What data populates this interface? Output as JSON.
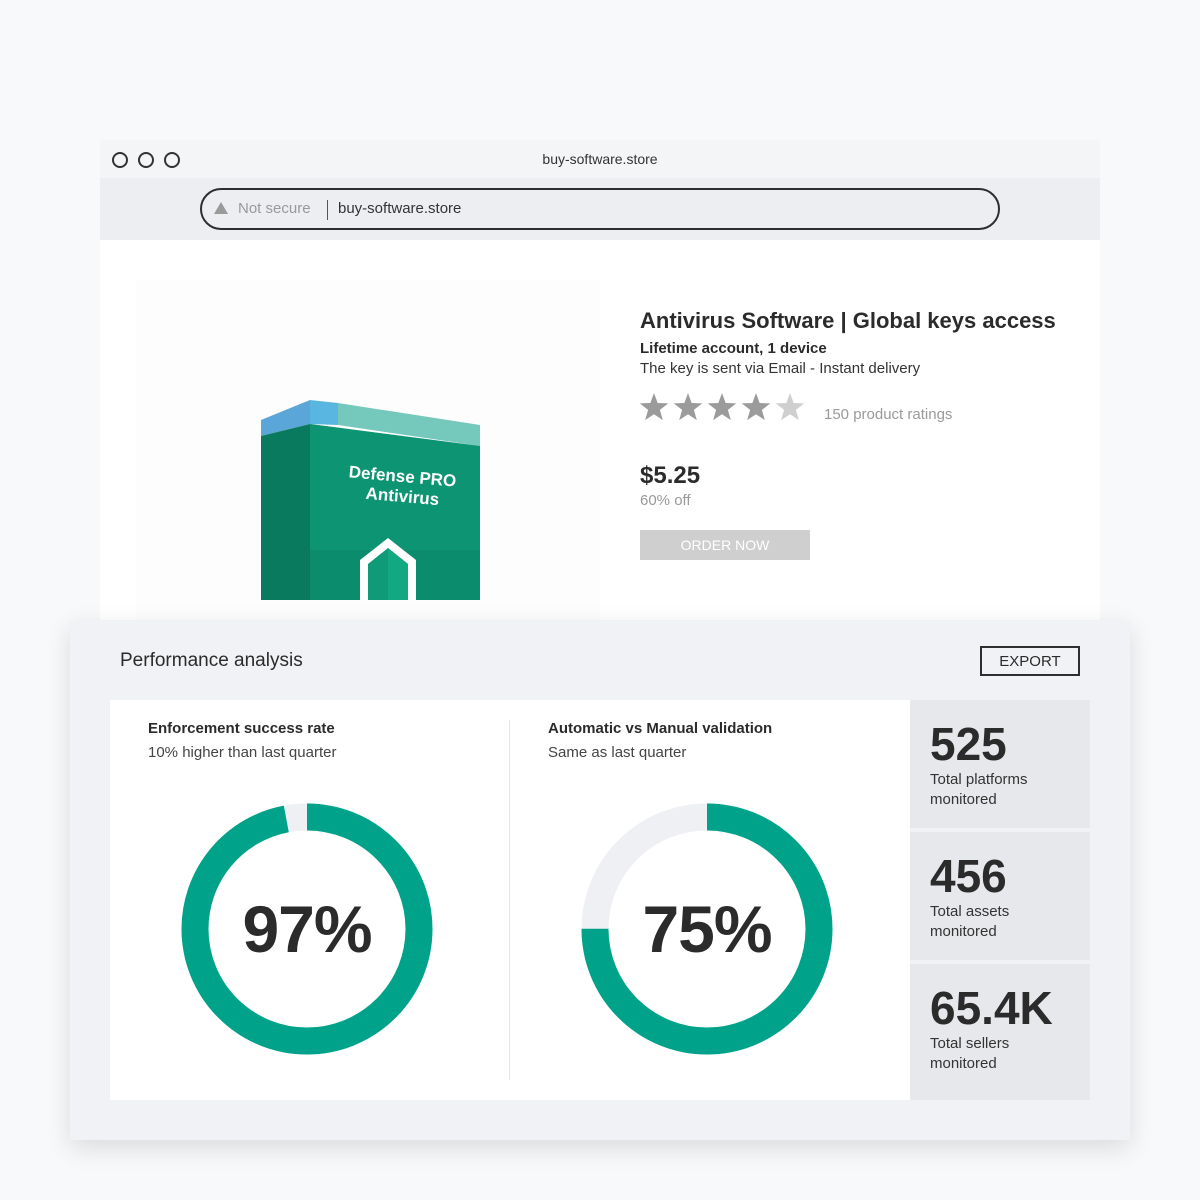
{
  "browser": {
    "tab_title": "buy-software.store",
    "security_label": "Not secure",
    "url": "buy-software.store"
  },
  "product": {
    "box_text_line1": "Defense PRO",
    "box_text_line2": "Antivirus",
    "title": "Antivirus Software | Global keys access",
    "subtitle": "Lifetime account, 1 device",
    "delivery": "The key is sent via Email - Instant delivery",
    "rating_stars": 4,
    "rating_max": 5,
    "ratings_count": "150 product ratings",
    "price": "$5.25",
    "discount": "60% off",
    "order_label": "ORDER NOW"
  },
  "panel": {
    "title": "Performance analysis",
    "export_label": "EXPORT",
    "metrics": [
      {
        "title": "Enforcement success rate",
        "subtitle": "10% higher than last quarter",
        "value_label": "97%",
        "value": 0.97
      },
      {
        "title": "Automatic vs Manual validation",
        "subtitle": "Same as last quarter",
        "value_label": "75%",
        "value": 0.75
      }
    ],
    "stats": [
      {
        "value": "525",
        "label": "Total platforms monitored"
      },
      {
        "value": "456",
        "label": "Total assets monitored"
      },
      {
        "value": "65.4K",
        "label": "Total sellers monitored"
      }
    ]
  },
  "colors": {
    "accent": "#00a389",
    "track": "#eef0f4",
    "star_filled": "#9b9b9b",
    "star_empty": "#cfcfcf"
  }
}
